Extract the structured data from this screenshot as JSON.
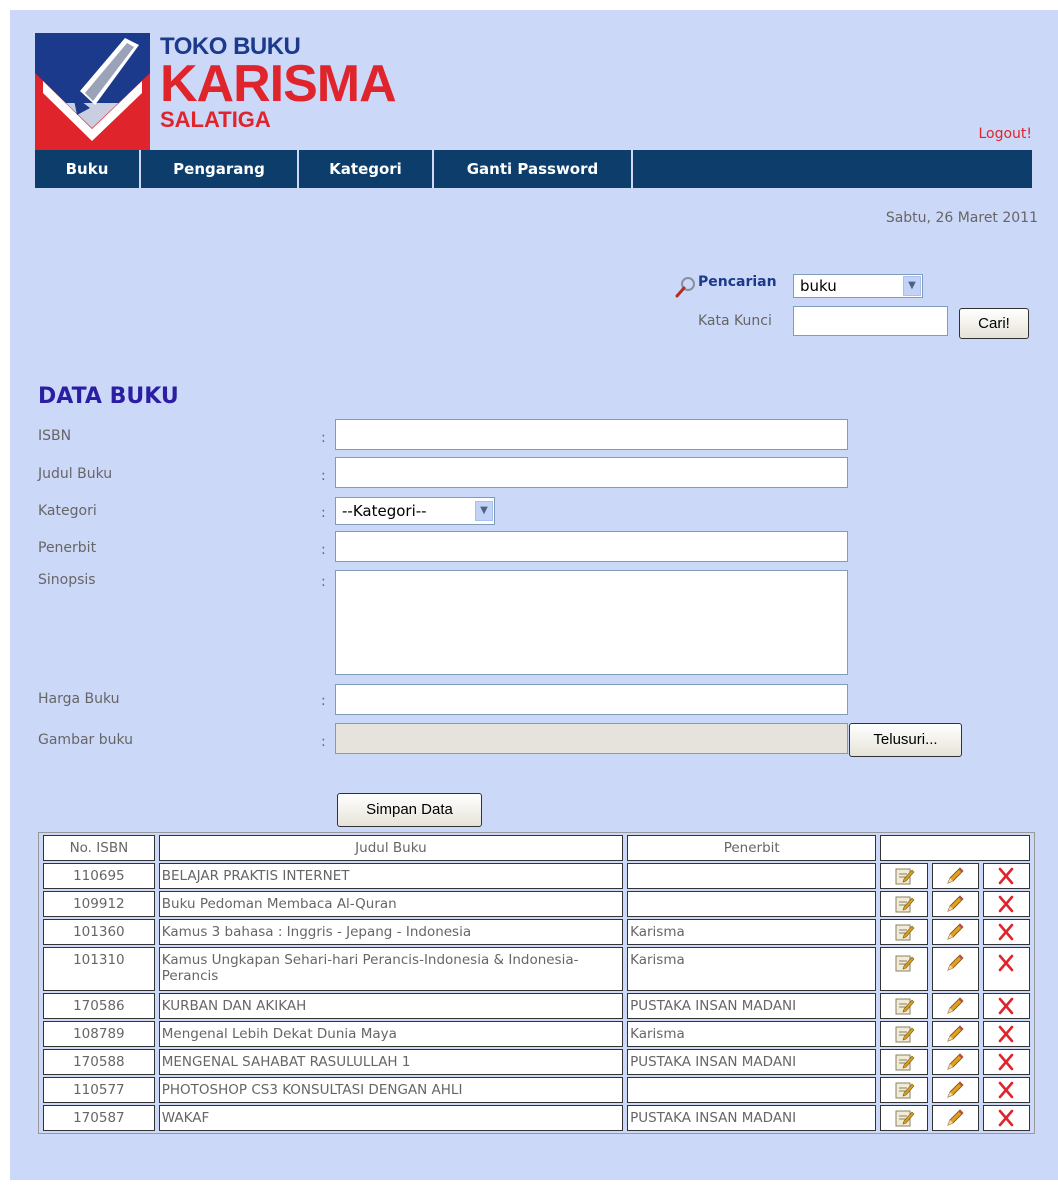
{
  "brand": {
    "line1": "TOKO BUKU",
    "line2": "KARISMA",
    "line3": "SALATIGA",
    "colors": {
      "blue": "#1b3a8c",
      "red": "#e0242c"
    }
  },
  "header": {
    "logout_label": "Logout!"
  },
  "nav": {
    "items": [
      {
        "label": "Buku"
      },
      {
        "label": "Pengarang"
      },
      {
        "label": "Kategori"
      },
      {
        "label": "Ganti Password"
      }
    ]
  },
  "date_text": "Sabtu, 26 Maret 2011",
  "search": {
    "label": "Pencarian",
    "type_selected": "buku",
    "keyword_label": "Kata Kunci",
    "keyword_value": "",
    "button_label": "Cari!"
  },
  "form": {
    "title": "DATA BUKU",
    "colon": ":",
    "fields": {
      "isbn": {
        "label": "ISBN",
        "value": ""
      },
      "judul": {
        "label": "Judul Buku",
        "value": ""
      },
      "kategori": {
        "label": "Kategori",
        "selected": "--Kategori--"
      },
      "penerbit": {
        "label": "Penerbit",
        "value": ""
      },
      "sinopsis": {
        "label": "Sinopsis",
        "value": ""
      },
      "harga": {
        "label": "Harga Buku",
        "value": ""
      },
      "gambar": {
        "label": "Gambar buku",
        "value": ""
      }
    },
    "browse_label": "Telusuri...",
    "save_label": "Simpan Data"
  },
  "table": {
    "headers": {
      "isbn": "No. ISBN",
      "title": "Judul Buku",
      "publisher": "Penerbit"
    },
    "rows": [
      {
        "isbn": "110695",
        "title": "BELAJAR PRAKTIS INTERNET",
        "publisher": ""
      },
      {
        "isbn": "109912",
        "title": "Buku Pedoman Membaca Al-Quran",
        "publisher": ""
      },
      {
        "isbn": "101360",
        "title": "Kamus 3 bahasa : Inggris - Jepang - Indonesia",
        "publisher": "Karisma"
      },
      {
        "isbn": "101310",
        "title": "Kamus Ungkapan Sehari-hari Perancis-Indonesia & Indonesia-Perancis",
        "publisher": "Karisma"
      },
      {
        "isbn": "170586",
        "title": "KURBAN DAN AKIKAH",
        "publisher": "PUSTAKA INSAN MADANI"
      },
      {
        "isbn": "108789",
        "title": "Mengenal Lebih Dekat Dunia Maya",
        "publisher": "Karisma"
      },
      {
        "isbn": "170588",
        "title": "MENGENAL SAHABAT RASULULLAH 1",
        "publisher": "PUSTAKA INSAN MADANI"
      },
      {
        "isbn": "110577",
        "title": "PHOTOSHOP CS3 KONSULTASI DENGAN AHLI",
        "publisher": ""
      },
      {
        "isbn": "170587",
        "title": "WAKAF",
        "publisher": "PUSTAKA INSAN MADANI"
      }
    ],
    "row_actions": [
      "detail-icon",
      "edit-icon",
      "delete-icon"
    ]
  }
}
